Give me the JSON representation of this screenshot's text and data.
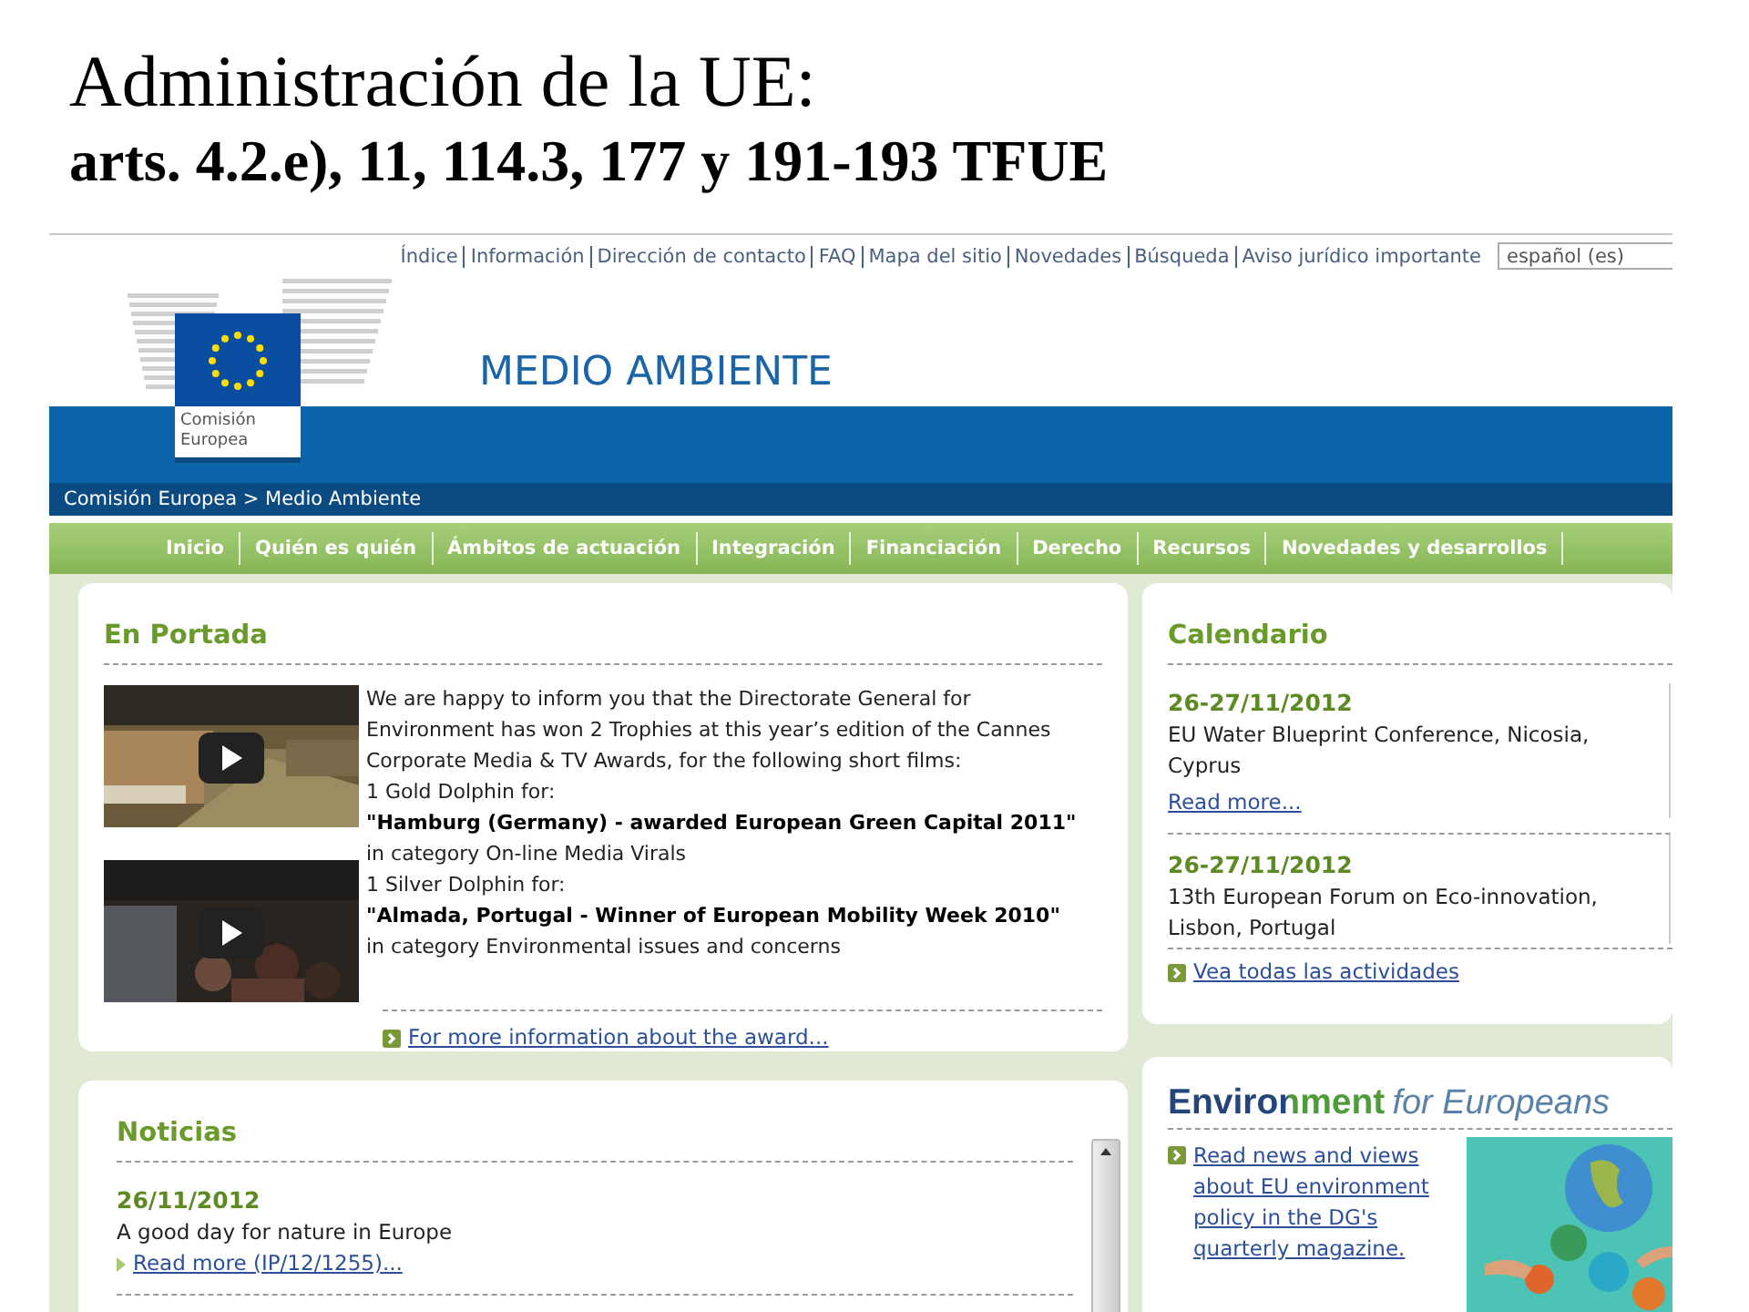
{
  "slide": {
    "title": "Administración de la UE:",
    "subtitle": "arts. 4.2.e), 11, 114.3, 177 y 191-193 TFUE"
  },
  "top_links": [
    "Índice",
    "Información",
    "Dirección de contacto",
    "FAQ",
    "Mapa del sitio",
    "Novedades",
    "Búsqueda",
    "Aviso jurídico importante"
  ],
  "language": "español (es)",
  "logo_text": [
    "Comisión",
    "Europea"
  ],
  "site_title": "MEDIO AMBIENTE",
  "breadcrumb": "Comisión Europea > Medio Ambiente",
  "nav": [
    "Inicio",
    "Quién es quién",
    "Ámbitos de actuación",
    "Integración",
    "Financiación",
    "Derecho",
    "Recursos",
    "Novedades y desarrollos"
  ],
  "portada": {
    "title": "En Portada",
    "lines": [
      {
        "kind": "text",
        "text": "We are happy to inform you that the Directorate General for Environment has won 2 Trophies at this year’s edition of the Cannes Corporate Media & TV Awards, for the following short films:"
      },
      {
        "kind": "text",
        "text": "1 Gold Dolphin for:"
      },
      {
        "kind": "bold",
        "text": "\"Hamburg (Germany) - awarded European Green Capital 2011\""
      },
      {
        "kind": "text",
        "text": "in category On-line Media Virals"
      },
      {
        "kind": "text",
        "text": "1 Silver Dolphin for:"
      },
      {
        "kind": "bold",
        "text": "\"Almada, Portugal - Winner of European Mobility Week 2010\""
      },
      {
        "kind": "text",
        "text": "in category Environmental issues and concerns"
      }
    ],
    "link": "For more information about the award..."
  },
  "calendar": {
    "title": "Calendario",
    "events": [
      {
        "date": "26-27/11/2012",
        "text": "EU Water Blueprint Conference, Nicosia, Cyprus",
        "link": "Read more..."
      },
      {
        "date": "26-27/11/2012",
        "text": "13th European Forum on Eco-innovation, Lisbon, Portugal"
      }
    ],
    "link": "Vea todas las actividades"
  },
  "news": {
    "title": "Noticias",
    "items": [
      {
        "date": "26/11/2012",
        "text": "A good day for nature in Europe",
        "link": "Read more (IP/12/1255)..."
      }
    ]
  },
  "magazine": {
    "brand": "Environment",
    "tagline": "for Europeans",
    "link": "Read news and views about EU environment policy in the DG's quarterly magazine."
  }
}
